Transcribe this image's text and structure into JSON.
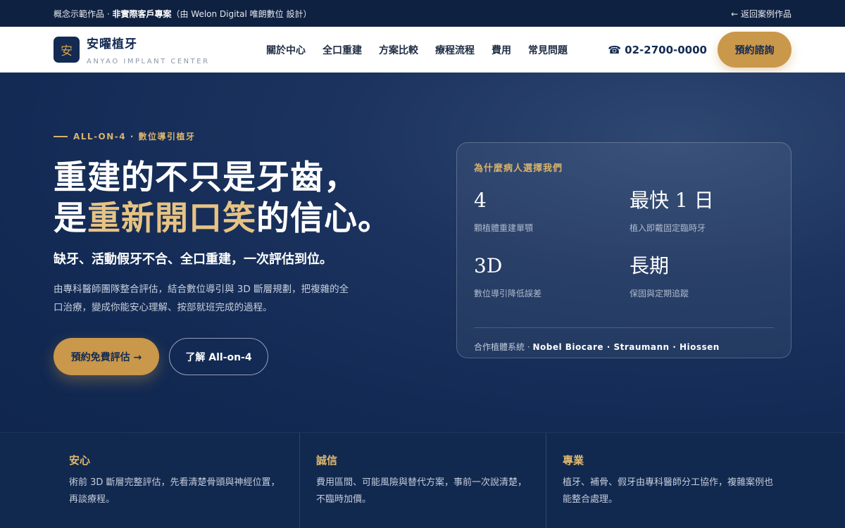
{
  "topbar": {
    "prefix": "概念示範作品 · ",
    "emphasis": "非實際客戶專案",
    "suffix": "（由 Welon Digital 唯朗數位 設計）",
    "back_link": "← 返回案例作品"
  },
  "header": {
    "logo_mark": "安",
    "brand_name": "安曜植牙",
    "brand_sub": "ANYAO IMPLANT CENTER",
    "nav": [
      "關於中心",
      "全口重建",
      "方案比較",
      "療程流程",
      "費用",
      "常見問題"
    ],
    "phone": "☎ 02-2700-0000",
    "cta": "預約諮詢"
  },
  "hero": {
    "eyebrow": "ALL-ON-4 · 數位導引植牙",
    "headline_line1": "重建的不只是牙齒，",
    "headline_line2_pre": "是",
    "headline_line2_gold": "重新開口笑",
    "headline_line2_post": "的信心。",
    "subheadline": "缺牙、活動假牙不合、全口重建，一次評估到位。",
    "body": "由專科醫師團隊整合評估，結合數位導引與 3D 斷層規劃，把複雜的全口治療，變成你能安心理解、按部就班完成的過程。",
    "primary_button": "預約免費評估 →",
    "secondary_button": "了解 All-on-4"
  },
  "card": {
    "title": "為什麼病人選擇我們",
    "stats": [
      {
        "value": "4",
        "label": "顆植體重建單顎"
      },
      {
        "value": "最快 1 日",
        "label": "植入即戴固定臨時牙"
      },
      {
        "value": "3D",
        "label": "數位導引降低誤差"
      },
      {
        "value": "長期",
        "label": "保固與定期追蹤"
      }
    ],
    "partners_prefix": "合作植體系統 · ",
    "partners": "Nobel Biocare · Straumann · Hiossen"
  },
  "features": [
    {
      "title": "安心",
      "text": "術前 3D 斷層完整評估，先看清楚骨頭與神經位置，再談療程。"
    },
    {
      "title": "誠信",
      "text": "費用區間、可能風險與替代方案，事前一次說清楚，不臨時加價。"
    },
    {
      "title": "專業",
      "text": "植牙、補骨、假牙由專科醫師分工協作，複雜案例也能整合處理。"
    }
  ],
  "colors": {
    "navy": "#132a52",
    "gold": "#c9984b",
    "gold_text": "#e7c383"
  }
}
